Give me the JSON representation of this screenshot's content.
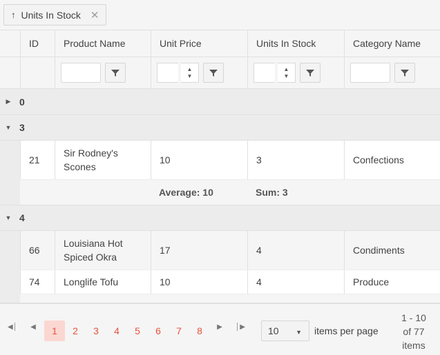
{
  "group_panel": {
    "chip_label": "Units In Stock",
    "sort_symbol": "↑",
    "close_symbol": "✕"
  },
  "columns": [
    "ID",
    "Product Name",
    "Unit Price",
    "Units In Stock",
    "Category Name"
  ],
  "groups": [
    {
      "value": "0",
      "expanded": false,
      "rows": [],
      "aggregates": null
    },
    {
      "value": "3",
      "expanded": true,
      "rows": [
        {
          "id": "21",
          "name": "Sir Rodney's Scones",
          "price": "10",
          "stock": "3",
          "category": "Confections"
        }
      ],
      "aggregates": {
        "price": "Average: 10",
        "stock": "Sum: 3"
      }
    },
    {
      "value": "4",
      "expanded": true,
      "rows": [
        {
          "id": "66",
          "name": "Louisiana Hot Spiced Okra",
          "price": "17",
          "stock": "4",
          "category": "Condiments"
        },
        {
          "id": "74",
          "name": "Longlife Tofu",
          "price": "10",
          "stock": "4",
          "category": "Produce"
        }
      ]
    }
  ],
  "pager": {
    "pages": [
      "1",
      "2",
      "3",
      "4",
      "5",
      "6",
      "7",
      "8"
    ],
    "current_page": "1",
    "page_size": "10",
    "items_per_page_label": "items per page",
    "info_lines": [
      "1 - 10",
      "of 77",
      "items"
    ]
  },
  "colors": {
    "accent": "#e8533e",
    "selected_page_bg": "#fbd7d2",
    "header_bg": "#f5f5f5",
    "group_bg": "#ececec"
  }
}
